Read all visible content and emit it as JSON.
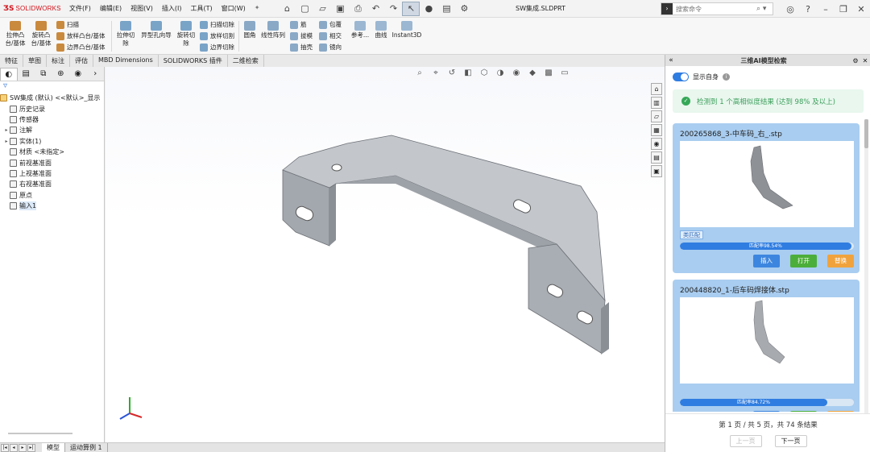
{
  "app": {
    "logo_text": "SOLIDWORKS",
    "document_title": "SW集成.SLDPRT"
  },
  "menu": [
    "文件(F)",
    "编辑(E)",
    "视图(V)",
    "插入(I)",
    "工具(T)",
    "窗口(W)"
  ],
  "search": {
    "placeholder": "搜索命令"
  },
  "ribbon": {
    "extrude_boss": "拉伸凸\n台/基体",
    "revolve_boss": "旋转凸\n台/基体",
    "sweep": "扫描",
    "loft_boss": "放样凸台/基体",
    "boundary_boss": "边界凸台/基体",
    "extrude_cut": "拉伸切\n除",
    "hole_wizard": "异型孔向导",
    "revolve_cut": "旋转切\n除",
    "sweep_cut": "扫描切除",
    "loft_cut": "放样切割",
    "boundary_cut": "边界切除",
    "fillet": "圆角",
    "linear_pattern": "线性阵列",
    "rib": "筋",
    "draft": "拔模",
    "shell": "抽壳",
    "wrap": "包覆",
    "intersect": "相交",
    "mirror": "镜向",
    "reference": "参考...",
    "curves": "曲线",
    "instant3d": "Instant3D"
  },
  "tabs": [
    "特征",
    "草图",
    "标注",
    "评估",
    "MBD Dimensions",
    "SOLIDWORKS 插件",
    "二维检索"
  ],
  "tree": {
    "root": "SW集成 (默认) <<默认>_显示",
    "items": [
      {
        "label": "历史记录",
        "expandable": false
      },
      {
        "label": "传感器",
        "expandable": false
      },
      {
        "label": "注解",
        "expandable": true
      },
      {
        "label": "实体(1)",
        "expandable": true
      },
      {
        "label": "材质 <未指定>",
        "expandable": false
      },
      {
        "label": "前视基准面",
        "expandable": false
      },
      {
        "label": "上视基准面",
        "expandable": false
      },
      {
        "label": "右视基准面",
        "expandable": false
      },
      {
        "label": "原点",
        "expandable": false
      },
      {
        "label": "输入1",
        "expandable": false
      }
    ]
  },
  "bottom_tabs": [
    "模型",
    "运动算例 1"
  ],
  "right_panel": {
    "title": "三维AI模型检索",
    "show_self_label": "显示自身",
    "alert": "检测到 1 个高相似度结果 (达到 98% 及以上)",
    "results": [
      {
        "filename": "200265868_3-中车码_右_.stp",
        "badge": "类匹配",
        "similarity_text": "匹配率98.54%",
        "similarity": 98.54,
        "buttons": [
          "插入",
          "打开",
          "替换"
        ]
      },
      {
        "filename": "200448820_1-后车码焊接体.stp",
        "badge": "",
        "similarity_text": "匹配率84.72%",
        "similarity": 84.72,
        "buttons": [
          "插入",
          "打开",
          "替换"
        ]
      }
    ],
    "pager": {
      "info": "第 1 页 / 共 5 页，共 74 条结果",
      "prev": "上一页",
      "next": "下一页"
    }
  },
  "colors": {
    "accent": "#2f7de1",
    "card_bg": "#a9cdf0",
    "success_text": "#3b9e5a",
    "btn_insert": "#3d86df",
    "btn_open": "#4cae3a",
    "btn_replace": "#f0a33c"
  }
}
